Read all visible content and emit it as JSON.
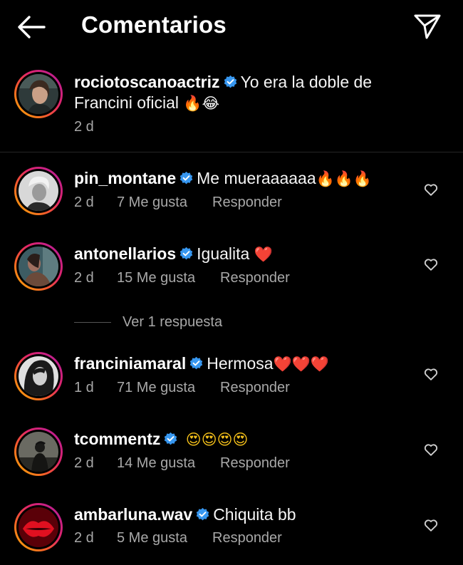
{
  "header": {
    "title": "Comentarios",
    "back_icon": "arrow-left-icon",
    "share_icon": "paper-plane-icon"
  },
  "caption": {
    "username": "rocio​toscanoactriz",
    "text": "Yo era la doble de Francini oficial",
    "emojis": "🔥😂",
    "time": "2 d"
  },
  "comments": [
    {
      "username": "pin_montane",
      "text": "Me mueraaaaaa",
      "emojis": "🔥🔥🔥",
      "time": "2 d",
      "likes": "7 Me gusta",
      "reply_label": "Responder"
    },
    {
      "username": "antonellarios",
      "text": "Igualita",
      "emojis": "❤️",
      "time": "2 d",
      "likes": "15 Me gusta",
      "reply_label": "Responder"
    },
    {
      "username": "franciniamaral",
      "text": "Hermosa",
      "emojis": "❤️❤️❤️",
      "time": "1 d",
      "likes": "71 Me gusta",
      "reply_label": "Responder"
    },
    {
      "username": "tcommentz",
      "text": "",
      "emojis": "😍😍😍😍",
      "time": "2 d",
      "likes": "14 Me gusta",
      "reply_label": "Responder"
    },
    {
      "username": "ambarluna.wav",
      "text": "Chiquita bb",
      "emojis": "",
      "time": "2 d",
      "likes": "5 Me gusta",
      "reply_label": "Responder"
    }
  ],
  "view_replies_label": "Ver 1 respuesta",
  "colors": {
    "background": "#000000",
    "secondary_text": "#a8a8a8",
    "verified_badge": "#3797f0"
  }
}
